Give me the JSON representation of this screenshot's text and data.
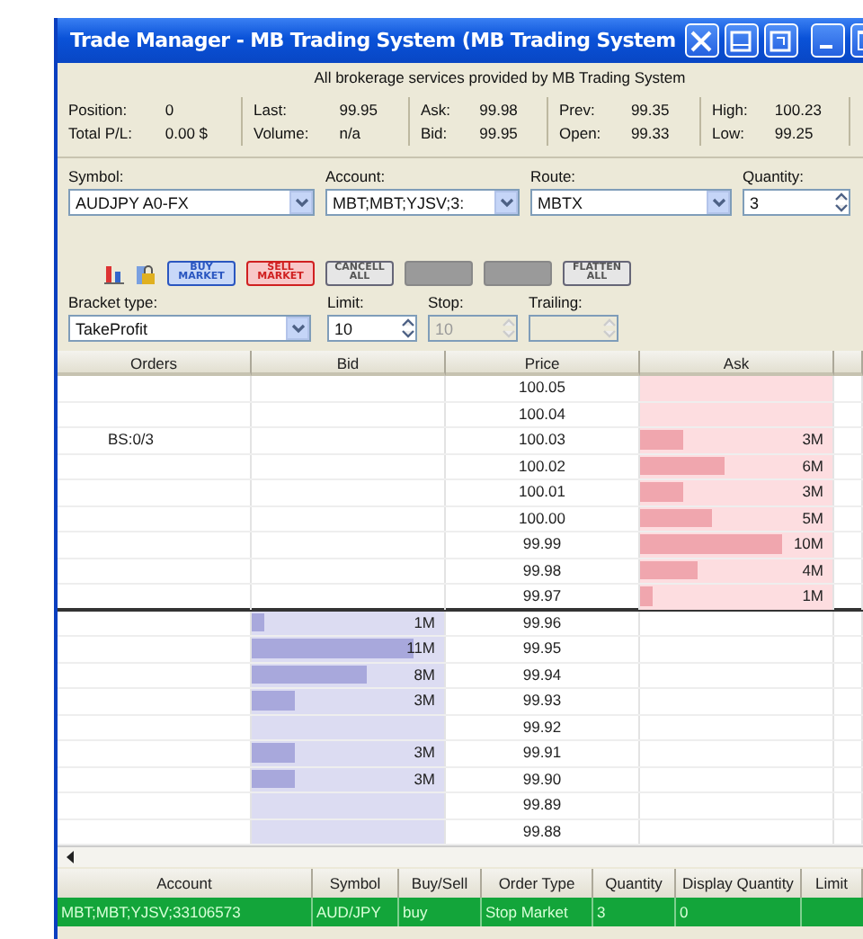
{
  "window": {
    "title": "Trade Manager - MB Trading System (MB Trading System"
  },
  "notice": "All brokerage services provided by MB Trading System",
  "stats": [
    {
      "items": [
        {
          "label": "Position:",
          "value": "0"
        },
        {
          "label": "Total P/L:",
          "value": "0.00 $"
        }
      ]
    },
    {
      "items": [
        {
          "label": "Last:",
          "value": "99.95"
        },
        {
          "label": "Volume:",
          "value": "n/a"
        }
      ]
    },
    {
      "items": [
        {
          "label": "Ask:",
          "value": "99.98"
        },
        {
          "label": "Bid:",
          "value": "99.95"
        }
      ]
    },
    {
      "items": [
        {
          "label": "Prev:",
          "value": "99.35"
        },
        {
          "label": "Open:",
          "value": "99.33"
        }
      ]
    },
    {
      "items": [
        {
          "label": "High:",
          "value": "100.23"
        },
        {
          "label": "Low:",
          "value": "99.25"
        }
      ]
    }
  ],
  "order_fields": [
    {
      "label": "Symbol:",
      "value": "AUDJPY A0-FX",
      "kind": "dropdown",
      "disabled": false
    },
    {
      "label": "Account:",
      "value": "MBT;MBT;YJSV;3:",
      "kind": "dropdown",
      "disabled": false
    },
    {
      "label": "Route:",
      "value": "MBTX",
      "kind": "dropdown",
      "disabled": false
    },
    {
      "label": "Quantity:",
      "value": "3",
      "kind": "spinner",
      "disabled": false
    }
  ],
  "toolbar": [
    {
      "kind": "chart-tool"
    },
    {
      "kind": "lock-tool"
    },
    {
      "kind": "buy",
      "label": "BUY MARKET",
      "disabled": false
    },
    {
      "kind": "sell",
      "label": "SELL MARKET",
      "disabled": false
    },
    {
      "kind": "plain",
      "label": "CANCELL ALL",
      "disabled": false
    },
    {
      "kind": "plain",
      "disabled": true
    },
    {
      "kind": "plain",
      "disabled": true
    },
    {
      "kind": "plain",
      "label": "FLATTEN ALL",
      "disabled": false
    }
  ],
  "bracket_fields": [
    {
      "label": "Bracket type:",
      "value": "TakeProfit",
      "kind": "dropdown",
      "disabled": false
    },
    {
      "label": "Limit:",
      "value": "10",
      "kind": "spinner",
      "disabled": false
    },
    {
      "label": "Stop:",
      "value": "10",
      "kind": "spinner",
      "disabled": true
    },
    {
      "label": "Trailing:",
      "kind": "spinner",
      "disabled": true
    }
  ],
  "ladder": {
    "columns": [
      "Orders",
      "Bid",
      "Price",
      "Ask"
    ],
    "rows": [
      {
        "price": "100.05",
        "ask_side": true
      },
      {
        "price": "100.04",
        "ask_side": true
      },
      {
        "price": "100.03",
        "ask_side": true,
        "orders": "BS:0/3",
        "ask": {
          "size": "3M",
          "level": 0.22
        }
      },
      {
        "price": "100.02",
        "ask_side": true,
        "ask": {
          "size": "6M",
          "level": 0.44
        }
      },
      {
        "price": "100.01",
        "ask_side": true,
        "ask": {
          "size": "3M",
          "level": 0.22
        }
      },
      {
        "price": "100.00",
        "ask_side": true,
        "ask": {
          "size": "5M",
          "level": 0.37
        }
      },
      {
        "price": "99.99",
        "ask_side": true,
        "ask": {
          "size": "10M",
          "level": 0.74
        }
      },
      {
        "price": "99.98",
        "ask_side": true,
        "ask": {
          "size": "4M",
          "level": 0.3
        }
      },
      {
        "price": "99.97",
        "ask_side": true,
        "ask": {
          "size": "1M",
          "level": 0.07
        }
      },
      {
        "price": "99.96",
        "ask_side": false,
        "bid": {
          "size": "1M",
          "level": 0.07
        }
      },
      {
        "price": "99.95",
        "ask_side": false,
        "bid": {
          "size": "11M",
          "level": 0.84
        }
      },
      {
        "price": "99.94",
        "ask_side": false,
        "bid": {
          "size": "8M",
          "level": 0.6
        }
      },
      {
        "price": "99.93",
        "ask_side": false,
        "bid": {
          "size": "3M",
          "level": 0.22
        }
      },
      {
        "price": "99.92",
        "ask_side": false
      },
      {
        "price": "99.91",
        "ask_side": false,
        "bid": {
          "size": "3M",
          "level": 0.22
        }
      },
      {
        "price": "99.90",
        "ask_side": false,
        "bid": {
          "size": "3M",
          "level": 0.22
        }
      },
      {
        "price": "99.89",
        "ask_side": false
      },
      {
        "price": "99.88",
        "ask_side": false
      }
    ]
  },
  "orders": {
    "columns": [
      "Account",
      "Symbol",
      "Buy/Sell",
      "Order Type",
      "Quantity",
      "Display Quantity",
      "Limit"
    ],
    "rows": [
      {
        "selected": true,
        "cells": [
          "MBT;MBT;YJSV;33106573",
          "AUD/JPY",
          "buy",
          "Stop Market",
          "3",
          "0"
        ]
      }
    ]
  }
}
